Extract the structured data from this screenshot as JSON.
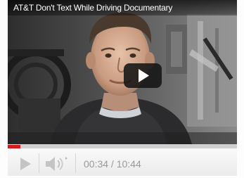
{
  "video": {
    "title": "AT&T Don't Text While Driving Documentary",
    "progress_fraction": 0.054
  },
  "controls": {
    "time_display": "00:34 / 10:44",
    "progress_color": "#d31b1b"
  },
  "icons": {
    "overlay": "play-icon",
    "play": "play-icon",
    "volume": "speaker-icon"
  }
}
